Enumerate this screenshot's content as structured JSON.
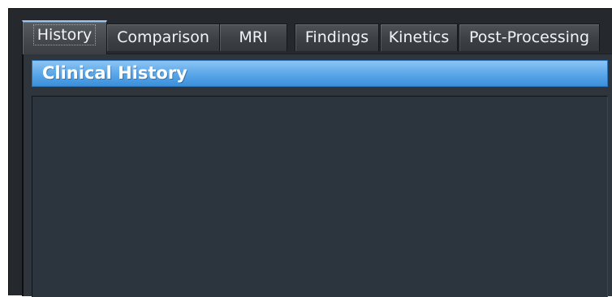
{
  "tabs": [
    {
      "label": "History",
      "active": true
    },
    {
      "label": "Comparison",
      "active": false
    },
    {
      "label": "MRI",
      "active": false
    },
    {
      "label": "Findings",
      "active": false
    },
    {
      "label": "Kinetics",
      "active": false
    },
    {
      "label": "Post-Processing",
      "active": false
    }
  ],
  "section": {
    "title": "Clinical History"
  },
  "clinical_history": {
    "value": ""
  },
  "colors": {
    "background": "#25292e",
    "panel": "#2f353c",
    "textarea": "#2c343e",
    "header_accent": "#5aa7e9",
    "header_text": "#ffffff"
  }
}
